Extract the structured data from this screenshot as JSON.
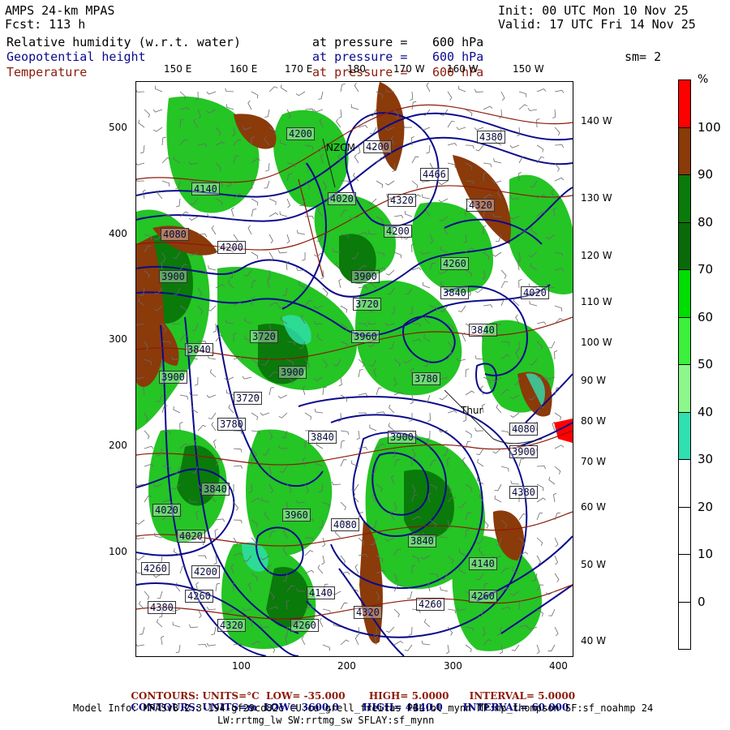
{
  "header": {
    "model": "AMPS 24-km MPAS",
    "fcst": "Fcst: 113 h",
    "init": "Init: 00 UTC Mon 10 Nov 25",
    "valid": "Valid: 17 UTC Fri 14 Nov 25",
    "field1_name": "Relative humidity (w.r.t. water)",
    "field2_name": "Geopotential height",
    "field3_name": "Temperature",
    "pressure_text": "at pressure =",
    "pressure_value": "600 hPa",
    "smoothing": "sm= 2"
  },
  "top_axis_labels": [
    "150 E",
    "160 E",
    "170 E",
    "180",
    "170 W",
    "160 W",
    "150 W"
  ],
  "right_axis_labels": [
    "140 W",
    "130 W",
    "120 W",
    "110 W",
    "100 W",
    "90 W",
    "80 W",
    "70 W",
    "60 W",
    "50 W",
    "40 W"
  ],
  "left_axis_labels": [
    "500",
    "400",
    "300",
    "200",
    "100"
  ],
  "bottom_axis_labels": [
    "100",
    "200",
    "300",
    "400"
  ],
  "height_labels": [
    "4200",
    "4200",
    "4380",
    "4466",
    "4320",
    "4320",
    "4140",
    "4080",
    "4200",
    "4200",
    "4260",
    "4020",
    "3900",
    "3900",
    "3720",
    "3840",
    "3720",
    "3840",
    "3960",
    "3840",
    "3780",
    "3900",
    "3900",
    "3720",
    "3780",
    "3840",
    "3900",
    "4080",
    "3900",
    "3840",
    "3960",
    "4020",
    "3840",
    "4080",
    "4140",
    "4020",
    "4260",
    "4200",
    "4140",
    "4260",
    "4380",
    "4320",
    "4260",
    "4320",
    "4260",
    "4260",
    "4020",
    "4380"
  ],
  "place_labels": [
    "NZCM",
    "Thur"
  ],
  "colorbar": {
    "unit": "%",
    "levels": [
      "100",
      "90",
      "80",
      "70",
      "60",
      "50",
      "40",
      "30",
      "20",
      "10",
      "0"
    ],
    "colors": [
      "#ff0000",
      "#8b3a0a",
      "#0a7a0a",
      "#0a6a0a",
      "#00dd00",
      "#3cf03c",
      "#8cf88c",
      "#30e0b0",
      "#ffffff",
      "#ffffff",
      "#ffffff",
      "#ffffff"
    ]
  },
  "footer": {
    "line1_label": "CONTOURS:",
    "line1_units": "UNITS=°C",
    "line1_low": "LOW= -35.000",
    "line1_high": "HIGH= 5.0000",
    "line1_interval": "INTERVAL= 5.0000",
    "line2_label": "CONTOURS:",
    "line2_units": "UNITS=m",
    "line2_low": "LOW= 3600.0",
    "line2_high": "HIGH= 4440.0",
    "line2_interval": "INTERVAL= 60.000",
    "model_info": "Model Info: MPASv8.2.3-194-gf29cd82c CU:cu_grell_freitas PBL:bl_mynn MP:mp_thompson SF:sf_noahmp 24",
    "model_info2": "LW:rrtmg_lw SW:rrtmg_sw SFLAY:sf_mynn"
  },
  "colors": {
    "height_contour": "#0a0a8c",
    "temp_contour": "#8c1a0a",
    "rh_high": "#8b3a0a",
    "rh_mid": "#0a7a0a",
    "rh_low": "#00dd00"
  }
}
